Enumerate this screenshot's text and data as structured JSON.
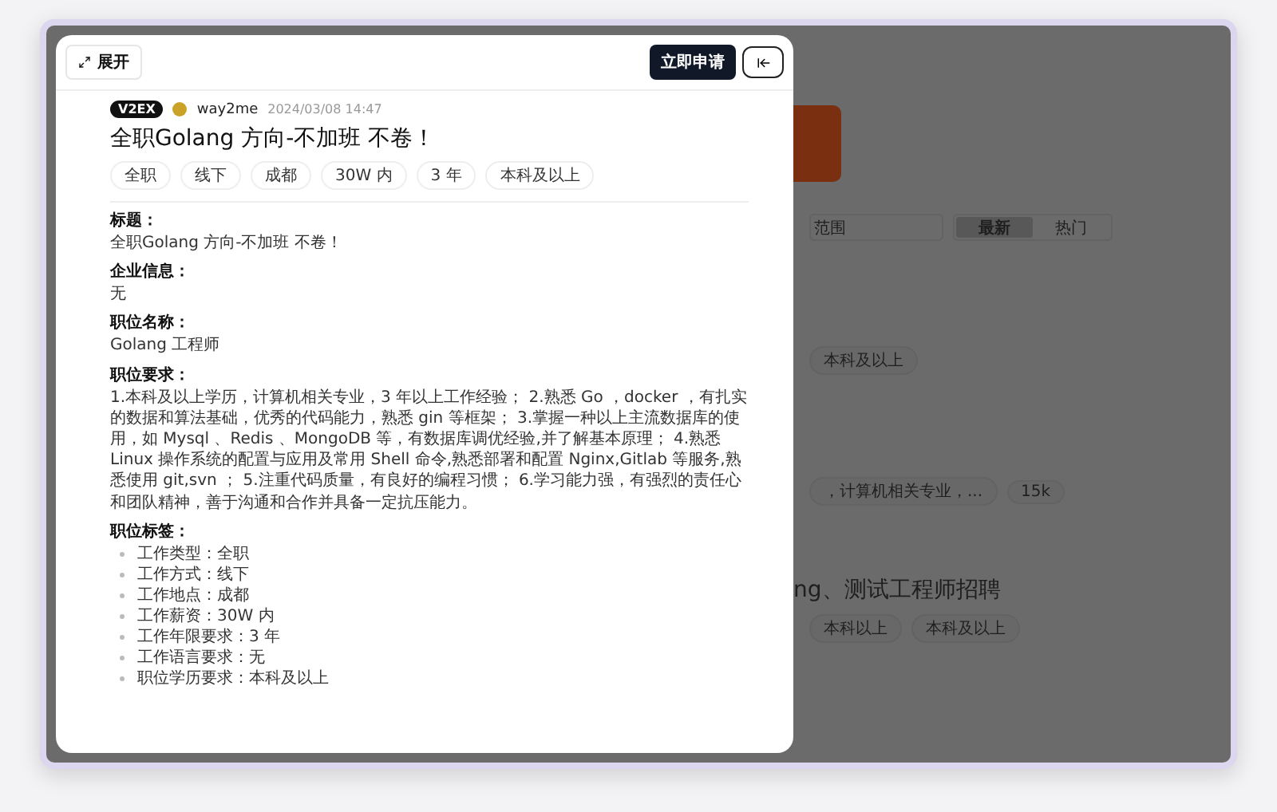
{
  "drawer": {
    "expand_button": "展开",
    "apply_button": "立即申请",
    "post": {
      "source": "V2EX",
      "author": "way2me",
      "date": "2024/03/08 14:47",
      "title": "全职Golang 方向-不加班 不卷！",
      "tags": [
        "全职",
        "线下",
        "成都",
        "30W 内",
        "3 年",
        "本科及以上"
      ]
    },
    "sections": [
      {
        "kind": "text",
        "heading": "标题：",
        "body": "全职Golang 方向-不加班 不卷！"
      },
      {
        "kind": "text",
        "heading": "企业信息：",
        "body": "无"
      },
      {
        "kind": "text",
        "heading": "职位名称：",
        "body": "Golang 工程师"
      },
      {
        "kind": "text",
        "heading": "职位要求：",
        "body": "1.本科及以上学历，计算机相关专业，3 年以上工作经验； 2.熟悉 Go ，docker ，有扎实的数据和算法基础，优秀的代码能力，熟悉 gin 等框架； 3.掌握一种以上主流数据库的使用，如 Mysql 、Redis 、MongoDB 等，有数据库调优经验,并了解基本原理； 4.熟悉 Linux 操作系统的配置与应用及常用 Shell 命令,熟悉部署和配置 Nginx,Gitlab 等服务,熟悉使用 git,svn ； 5.注重代码质量，有良好的编程习惯； 6.学习能力强，有强烈的责任心和团队精神，善于沟通和合作并具备一定抗压能力。"
      },
      {
        "kind": "list",
        "heading": "职位标签：",
        "items": [
          "工作类型：全职",
          "工作方式：线下",
          "工作地点：成都",
          "工作薪资：30W 内",
          "工作年限要求：3 年",
          "工作语言要求：无",
          "职位学历要求：本科及以上"
        ]
      }
    ]
  },
  "background": {
    "search": {
      "value": "范围"
    },
    "sort_tabs": [
      {
        "label": "最新",
        "selected": true
      },
      {
        "label": "热门",
        "selected": false
      }
    ],
    "filter_tag": "本科及以上",
    "listing_1": {
      "snippet": "，计算机相关专业，...",
      "salary": "15k"
    },
    "listing_2": {
      "title": "ng、测试工程师招聘",
      "tags": [
        "本科以上",
        "本科及以上"
      ]
    }
  }
}
